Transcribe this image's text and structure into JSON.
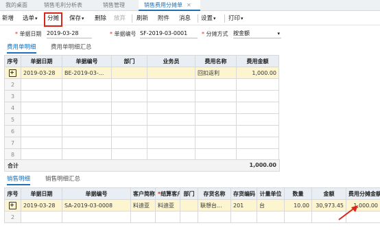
{
  "tabs": [
    {
      "label": "我的桌面"
    },
    {
      "label": "销售毛利分析表"
    },
    {
      "label": "销售管理"
    },
    {
      "label": "销售费用分摊单",
      "active": true
    }
  ],
  "toolbar": {
    "add": "新增",
    "select_bill": "选单",
    "split": "分摊",
    "save": "保存",
    "delete": "删除",
    "abandon": "放弃",
    "refresh": "刷新",
    "attachment": "附件",
    "message": "消息",
    "settings": "设置",
    "print": "打印"
  },
  "header": {
    "date_label": "单据日期",
    "date_value": "2019-03-28",
    "billno_label": "单据编号",
    "billno_value": "SF-2019-03-0001",
    "method_label": "分摊方式",
    "method_value": "按金额"
  },
  "top_tabs": [
    "费用单明细",
    "费用单明细汇总"
  ],
  "expense_grid": {
    "columns": [
      "序号",
      "单据日期",
      "单据编号",
      "部门",
      "业务员",
      "费用名称",
      "费用金额"
    ],
    "rows": [
      {
        "no": "",
        "date": "2019-03-28",
        "billno": "BE-2019-03-...",
        "dept": "",
        "salesman": "",
        "name": "回扣返利",
        "amount": "1,000.00"
      },
      {
        "no": "2"
      },
      {
        "no": "3"
      },
      {
        "no": "4"
      },
      {
        "no": "5"
      },
      {
        "no": "6"
      },
      {
        "no": "7"
      },
      {
        "no": "8"
      }
    ],
    "total_label": "合计",
    "total_value": "1,000.00"
  },
  "bottom_tabs": [
    "销售明细",
    "销售明细汇总"
  ],
  "sales_grid": {
    "columns": [
      "序号",
      "单据日期",
      "单据编号",
      "客户简称",
      "结算客户",
      "部门",
      "存货名称",
      "存货编码",
      "计量单位",
      "数量",
      "金额",
      "费用分摊金额"
    ],
    "rows": [
      {
        "no": "",
        "date": "2019-03-28",
        "billno": "SA-2019-03-0008",
        "cust": "料迪亚",
        "settle": "料迪亚",
        "dept": "",
        "inv": "联想台...",
        "code": "201",
        "unit": "台",
        "qty": "10.00",
        "amt": "30,973.45",
        "alloc": "1,000.00"
      },
      {
        "no": "2"
      }
    ]
  },
  "colors": {
    "accent": "#1f6fb5",
    "highlight_box": "#d9261c",
    "selected_row": "#fdf5cf"
  }
}
